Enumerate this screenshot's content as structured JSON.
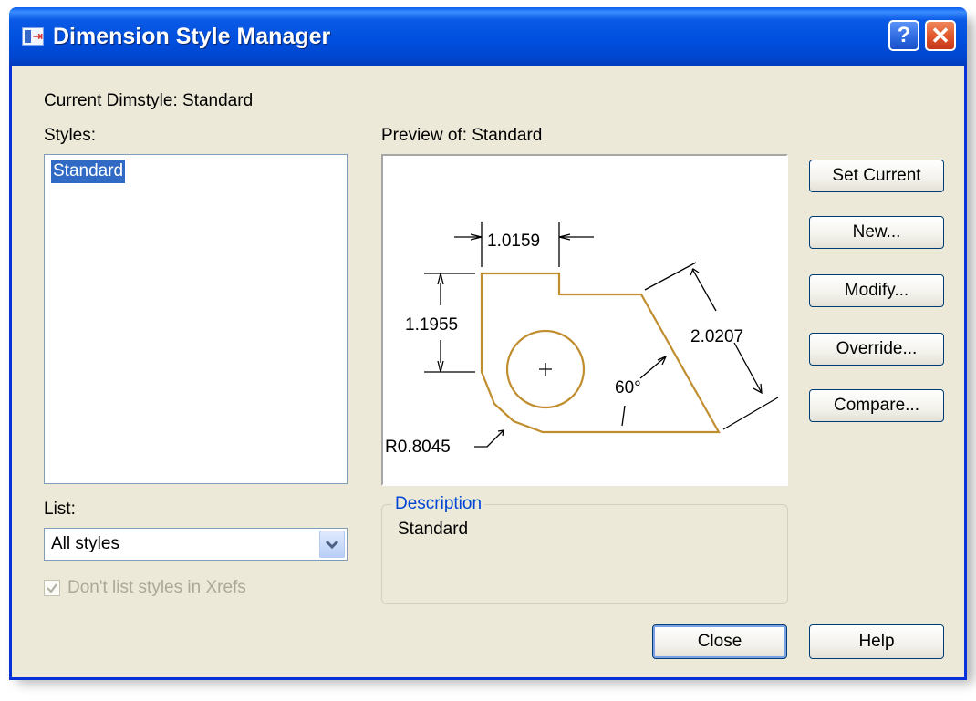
{
  "window": {
    "title": "Dimension Style Manager",
    "help_glyph": "?",
    "close_glyph": "✕"
  },
  "current_dimstyle": "Current Dimstyle: Standard",
  "styles": {
    "label": "Styles:",
    "items": [
      "Standard"
    ],
    "selected": "Standard"
  },
  "list": {
    "label": "List:",
    "selected": "All styles"
  },
  "xrefs_checkbox": {
    "label": "Don't list styles in Xrefs",
    "checked": true,
    "enabled": false
  },
  "preview": {
    "label": "Preview of: Standard",
    "dims": {
      "width": "1.0159",
      "height": "1.1955",
      "slant": "2.0207",
      "angle": "60°",
      "radius": "R0.8045"
    },
    "center_mark": "+"
  },
  "description": {
    "legend": "Description",
    "text": "Standard"
  },
  "buttons": {
    "set_current": "Set Current",
    "new": "New...",
    "modify": "Modify...",
    "override": "Override...",
    "compare": "Compare...",
    "close": "Close",
    "help": "Help"
  },
  "colors": {
    "title_bar": "#0054e3",
    "selection": "#316ac5",
    "outline": "#b8860b",
    "legend": "#0046d5"
  }
}
